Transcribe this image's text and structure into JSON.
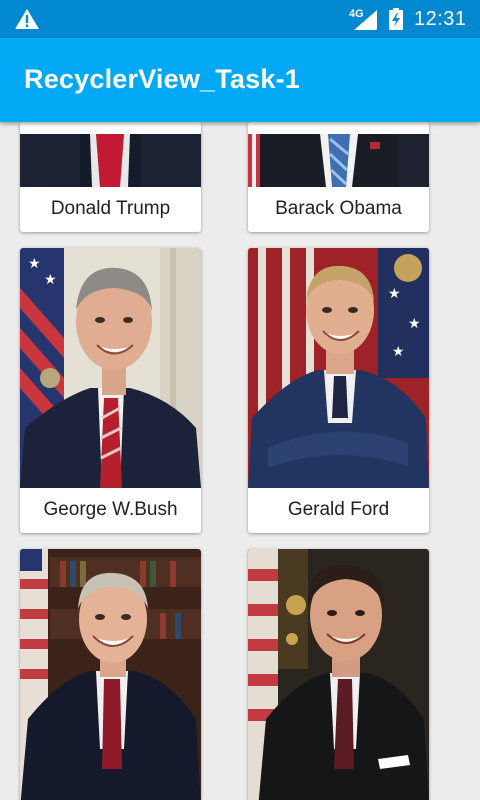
{
  "status_bar": {
    "network": "4G",
    "time": "12:31",
    "icons": [
      "warning-icon",
      "signal-icon",
      "battery-charging-icon"
    ]
  },
  "app_bar": {
    "title": "RecyclerView_Task-1"
  },
  "presidents": [
    {
      "name": "Donald Trump"
    },
    {
      "name": "Barack Obama"
    },
    {
      "name": "George W.Bush"
    },
    {
      "name": "Gerald Ford"
    },
    {
      "name": ""
    },
    {
      "name": ""
    }
  ],
  "colors": {
    "status_bar": "#0288d1",
    "app_bar": "#03a9f4",
    "background": "#ececec",
    "card": "#ffffff"
  }
}
